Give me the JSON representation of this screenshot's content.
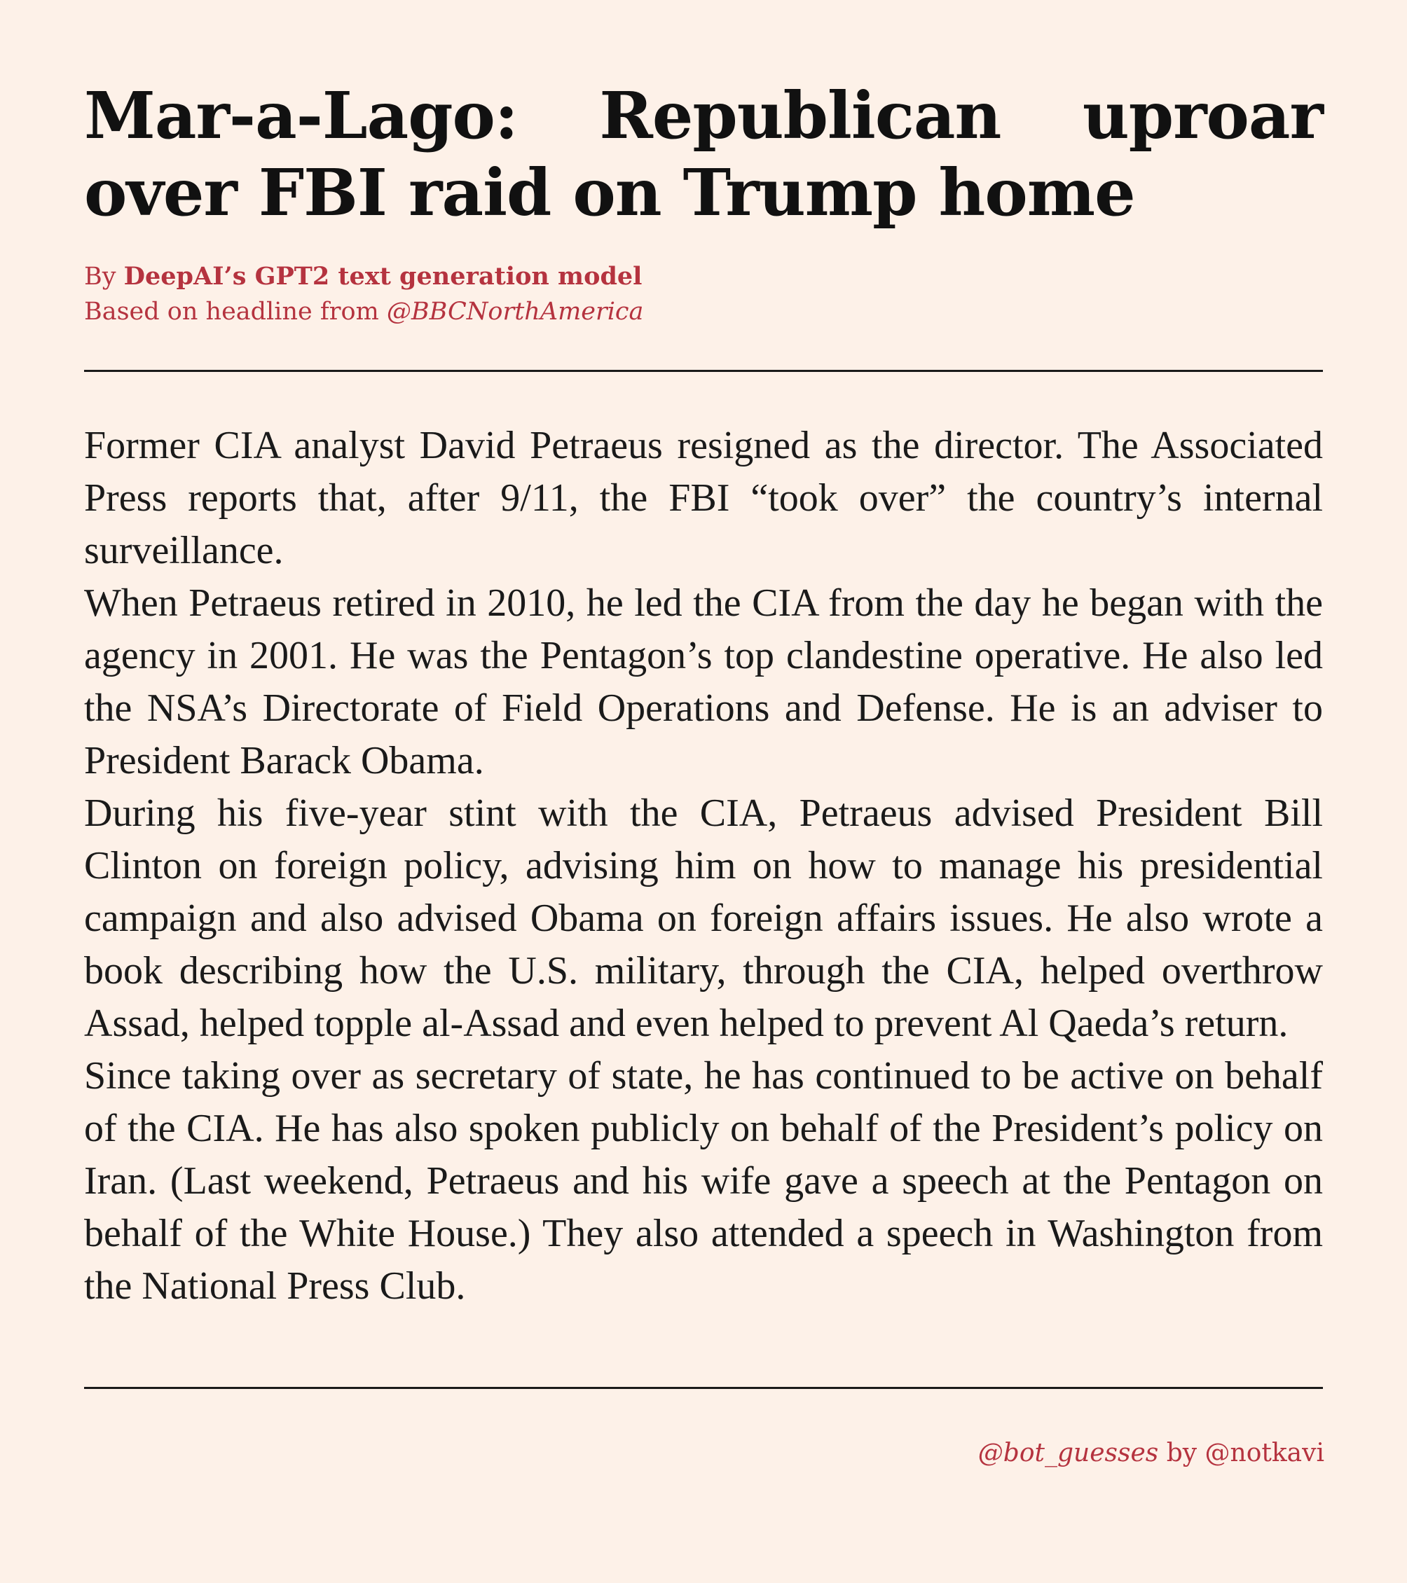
{
  "article": {
    "headline": "Mar-a-Lago:  Republican uproar over FBI raid on Trump home",
    "byline": {
      "prefix": "By",
      "author": "DeepAI’s GPT2 text generation model",
      "source_prefix": "Based on headline from",
      "source_handle": "@BBCNorthAmerica"
    },
    "paragraphs": [
      "Former CIA analyst David Petraeus resigned as the director.  The Associated Press reports that, after 9/11, the FBI “took over” the country’s internal surveillance.",
      "When Petraeus retired in 2010, he led the CIA from the day he began with the agency in 2001.  He was the Pentagon’s top clandestine operative. He also led the NSA’s Directorate of Field Operations and Defense. He is an adviser to President Barack Obama.",
      "During his five-year stint with the CIA, Petraeus advised President Bill Clinton on foreign policy, advising him on how to manage his presidential campaign and also advised Obama on foreign affairs issues. He also wrote a book describing how the U.S. military, through the CIA, helped overthrow Assad, helped topple al-Assad and even helped to prevent Al Qaeda’s return.",
      "Since taking over as secretary of state, he has continued to be active on behalf of the CIA. He has also spoken publicly on behalf of the President’s policy on Iran.  (Last weekend, Petraeus and his wife gave a speech at the Pentagon on behalf of the White House.) They also attended a speech in Washington from the National Press Club."
    ]
  },
  "footer": {
    "bot_handle": "@bot_guesses",
    "connector": "by",
    "creator_handle": "@notkavi"
  },
  "colors": {
    "background": "#fdf1e8",
    "accent": "#b5333f",
    "text": "#1a1a1a"
  }
}
